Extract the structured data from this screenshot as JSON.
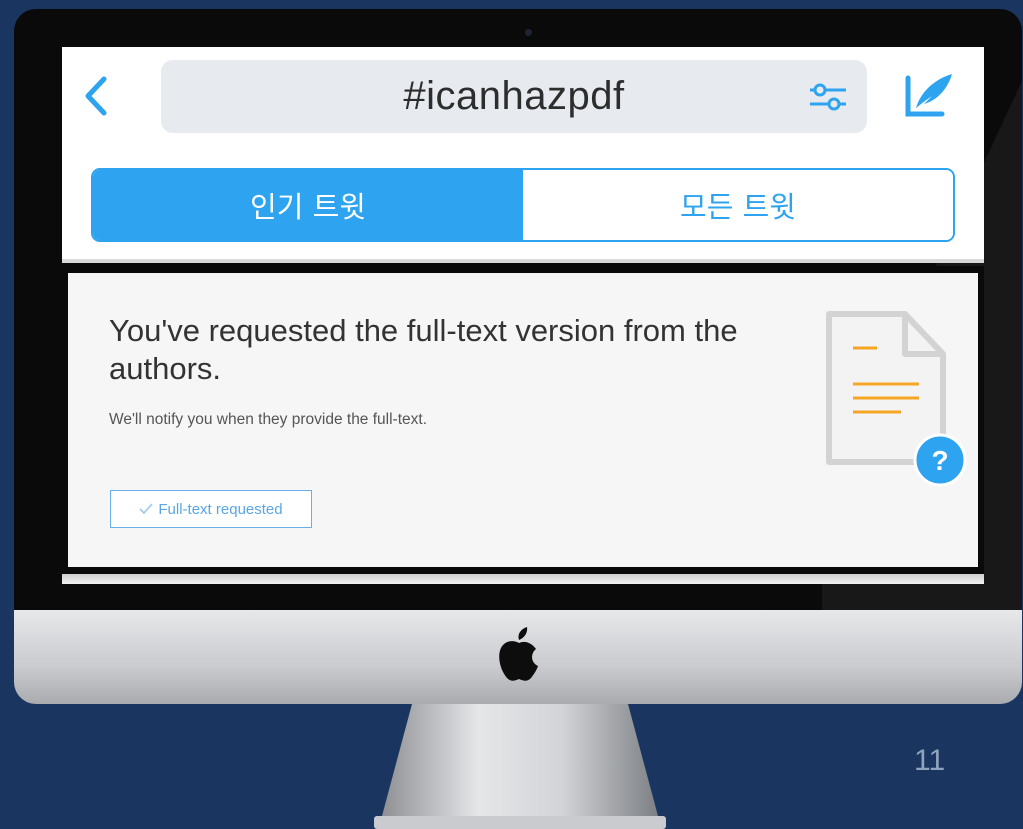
{
  "header": {
    "search_query": "#icanhazpdf",
    "icons": {
      "back": "chevron-left-icon",
      "filter": "sliders-icon",
      "compose": "compose-tweet-icon"
    },
    "accent_color": "#2ea3ef"
  },
  "tabs": [
    {
      "label": "인기 트윗",
      "selected": true
    },
    {
      "label": "모든 트윗",
      "selected": false
    }
  ],
  "notice": {
    "heading": "You've requested the full-text version from the authors.",
    "subtext": "We'll notify you when they provide the full-text.",
    "button_label": "Full-text requested",
    "button_icon": "checkmark-icon",
    "illustration_icon": "document-question-icon"
  },
  "slide": {
    "page_number": "11",
    "logo": "apple-logo"
  }
}
